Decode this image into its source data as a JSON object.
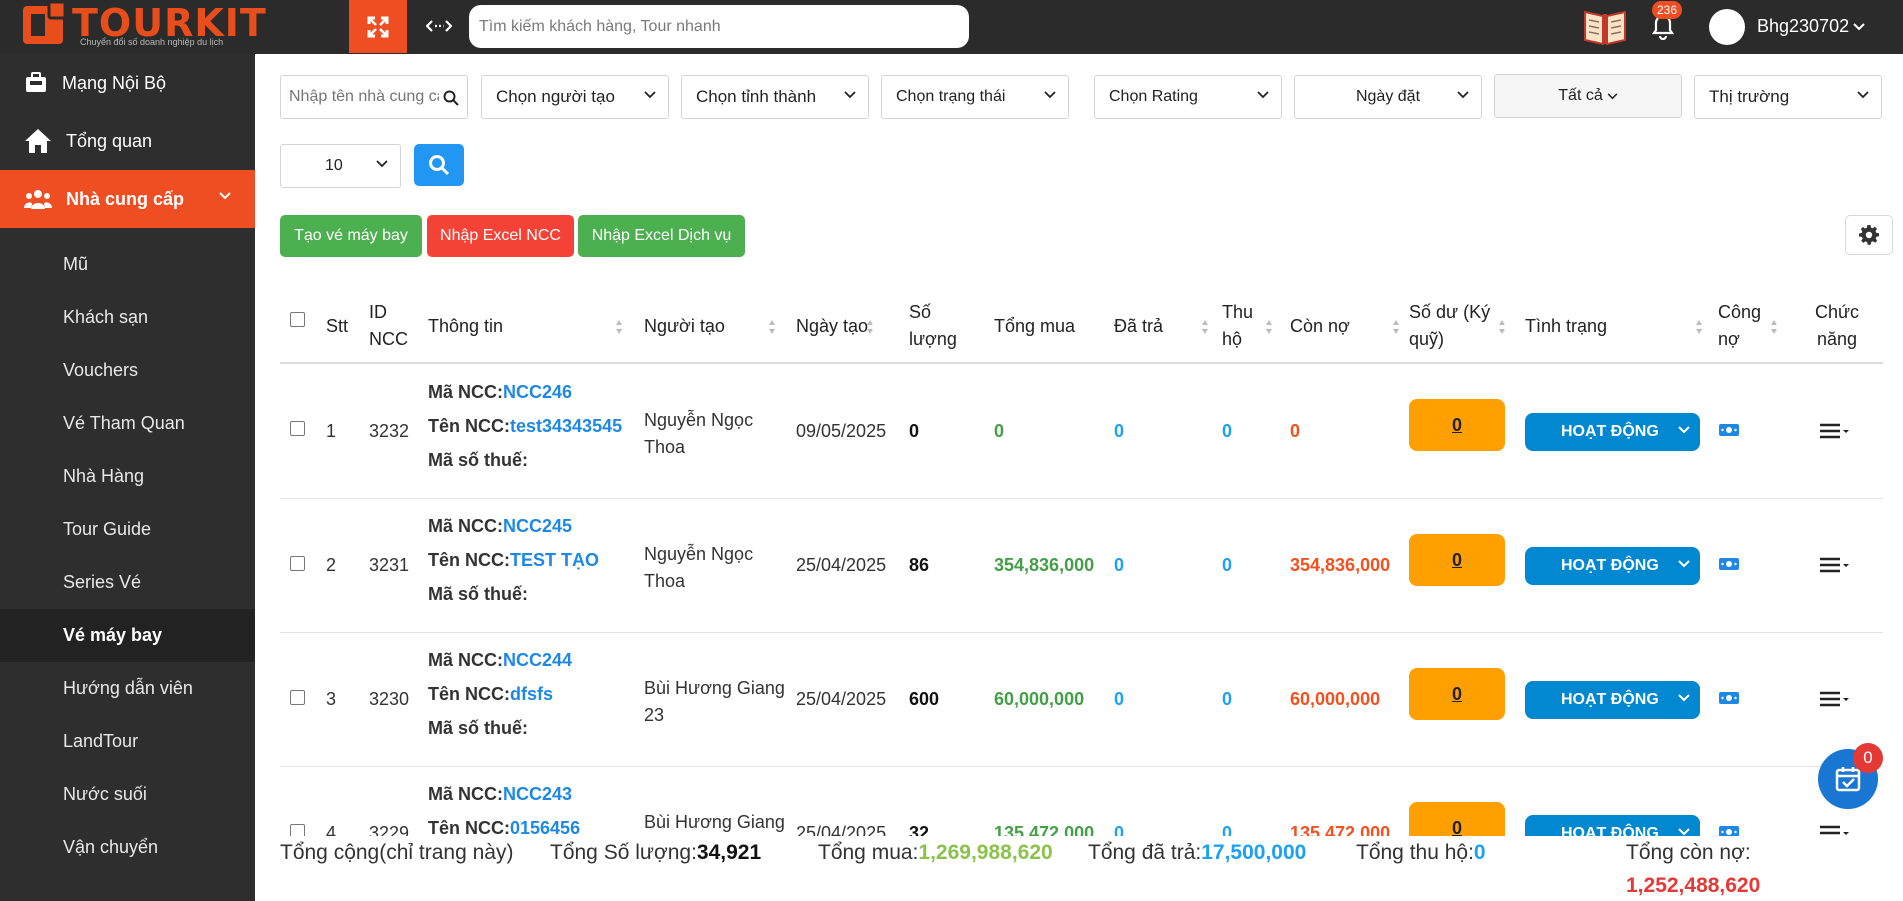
{
  "header": {
    "logo_text": "TOURKIT",
    "logo_tagline": "Chuyển đổi số doanh nghiệp du lịch",
    "search_placeholder": "Tìm kiếm khách hàng, Tour nhanh",
    "notification_count": "236",
    "user_name": "Bhg230702"
  },
  "sidebar": {
    "main_items": [
      {
        "label": "Mạng Nội Bộ",
        "icon": "briefcase-icon"
      },
      {
        "label": "Tổng quan",
        "icon": "home-icon"
      },
      {
        "label": "Nhà cung cấp",
        "icon": "users-icon",
        "active": true
      }
    ],
    "sub_items": [
      {
        "label": "Mũ"
      },
      {
        "label": "Khách sạn"
      },
      {
        "label": "Vouchers"
      },
      {
        "label": "Vé Tham Quan"
      },
      {
        "label": "Nhà Hàng"
      },
      {
        "label": "Tour Guide"
      },
      {
        "label": "Series Vé"
      },
      {
        "label": "Vé máy bay",
        "selected": true
      },
      {
        "label": "Hướng dẫn viên"
      },
      {
        "label": "LandTour"
      },
      {
        "label": "Nước suối"
      },
      {
        "label": "Vận chuyển"
      }
    ]
  },
  "filters": {
    "name_placeholder": "Nhập tên nhà cung cấp",
    "creator": "Chọn người tạo",
    "province": "Chọn tỉnh thành",
    "status": "Chọn trạng thái",
    "rating": "Chọn Rating",
    "order_date": "Ngày đặt",
    "all": "Tất cả",
    "market": "Thị trường",
    "page_size": "10"
  },
  "actions": {
    "create_ticket": "Tạo vé máy bay",
    "import_excel_ncc": "Nhập Excel NCC",
    "import_excel_service": "Nhập Excel Dịch vụ"
  },
  "table": {
    "headers": {
      "stt": "Stt",
      "id_line1": "ID",
      "id_line2": "NCC",
      "info": "Thông tin",
      "creator": "Người tạo",
      "created_date": "Ngày tạo",
      "qty_line1": "Số",
      "qty_line2": "lượng",
      "total_buy": "Tổng mua",
      "paid": "Đã trả",
      "collect_line1": "Thu",
      "collect_line2": "hộ",
      "debt": "Còn nợ",
      "balance_line1": "Số dư (Ký",
      "balance_line2": "quỹ)",
      "status": "Tình trạng",
      "ledger_line1": "Công",
      "ledger_line2": "nợ",
      "func_line1": "Chức",
      "func_line2": "năng"
    },
    "labels": {
      "code": "Mã NCC:",
      "name": "Tên NCC:",
      "tax": "Mã số thuế:"
    },
    "rows": [
      {
        "stt": "1",
        "id": "3232",
        "code": "NCC246",
        "name": "test34343545",
        "creator_line1": "Nguyễn Ngọc",
        "creator_line2": "Thoa",
        "date": "09/05/2025",
        "qty": "0",
        "total": "0",
        "paid": "0",
        "collect": "0",
        "debt": "0",
        "balance": "0",
        "status": "HOẠT ĐỘNG"
      },
      {
        "stt": "2",
        "id": "3231",
        "code": "NCC245",
        "name": "TEST TẠO",
        "creator_line1": "Nguyễn Ngọc",
        "creator_line2": "Thoa",
        "date": "25/04/2025",
        "qty": "86",
        "total": "354,836,000",
        "paid": "0",
        "collect": "0",
        "debt": "354,836,000",
        "balance": "0",
        "status": "HOẠT ĐỘNG"
      },
      {
        "stt": "3",
        "id": "3230",
        "code": "NCC244",
        "name": "dfsfs",
        "creator_line1": "Bùi Hương Giang",
        "creator_line2": "23",
        "date": "25/04/2025",
        "qty": "600",
        "total": "60,000,000",
        "paid": "0",
        "collect": "0",
        "debt": "60,000,000",
        "balance": "0",
        "status": "HOẠT ĐỘNG"
      },
      {
        "stt": "4",
        "id": "3229",
        "code": "NCC243",
        "name": "0156456",
        "creator_line1": "Bùi Hương Giang",
        "creator_line2": "",
        "date": "25/04/2025",
        "qty": "32",
        "total": "135,472,000",
        "paid": "0",
        "collect": "0",
        "debt": "135,472,000",
        "balance": "0",
        "status": "HOẠT ĐỘNG"
      }
    ]
  },
  "totals": {
    "label": "Tổng cộng(chỉ trang này)",
    "qty_label": "Tổng Số lượng:",
    "qty_value": "34,921",
    "buy_label": "Tổng mua:",
    "buy_value": "1,269,988,620",
    "paid_label": "Tổng đã trả:",
    "paid_value": "17,500,000",
    "collect_label": "Tổng thu hộ:",
    "collect_value": "0",
    "debt_label": "Tổng còn nợ:",
    "debt_value": "1,252,488,620"
  },
  "fab": {
    "badge": "0"
  },
  "colors": {
    "brand": "#ef4e23",
    "sidebar": "#2e2e2e",
    "primary": "#2196f3",
    "success": "#4caf50",
    "danger": "#f44336",
    "warning": "#ffa000"
  }
}
